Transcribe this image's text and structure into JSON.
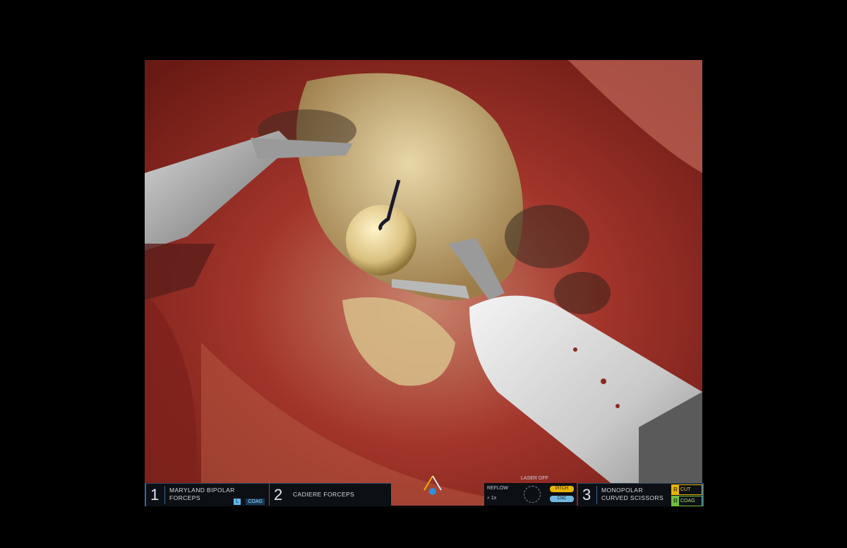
{
  "instruments": {
    "arm1": {
      "number": "1",
      "name_line1": "MARYLAND BIPOLAR",
      "name_line2": "FORCEPS",
      "mode_key": "L",
      "mode": "COAG"
    },
    "arm2": {
      "number": "2",
      "name": "CADIERE FORCEPS"
    },
    "arm3": {
      "number": "3",
      "name_line1": "MONOPOLAR",
      "name_line2": "CURVED SCISSORS",
      "cut_key": "R",
      "cut": "CUT",
      "coag_key": "R",
      "coag": "COAG"
    }
  },
  "status": {
    "title": "LASER OFF",
    "reflow": "REFLOW",
    "zoom": "1x",
    "pill_top": "PITCH",
    "pill_bottom": "CNC"
  },
  "colors": {
    "hud_bg": "#0c0f14",
    "accent_blue": "#2f6ca8",
    "cut_yellow": "#e7b400",
    "coag_green": "#6fbf3a",
    "tissue_red": "#a3352b"
  },
  "icons": [
    "camera-icon",
    "gauge-icon",
    "search-icon"
  ]
}
